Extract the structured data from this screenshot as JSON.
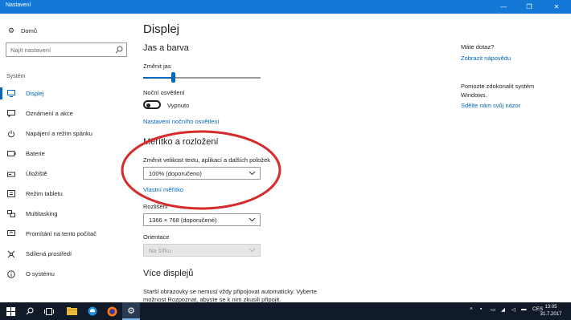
{
  "window": {
    "title": "Nastavení",
    "minimize_glyph": "—",
    "maximize_glyph": "❐",
    "close_glyph": "✕"
  },
  "nav": {
    "home_label": "Domů",
    "search_placeholder": "Najít nastavení",
    "group_label": "Systém",
    "items": [
      {
        "label": "Displej",
        "icon": "display-icon",
        "active": true
      },
      {
        "label": "Oznámení a akce",
        "icon": "notification-icon"
      },
      {
        "label": "Napájení a režim spánku",
        "icon": "power-icon"
      },
      {
        "label": "Baterie",
        "icon": "battery-icon"
      },
      {
        "label": "Úložiště",
        "icon": "storage-icon"
      },
      {
        "label": "Režim tabletu",
        "icon": "tablet-icon"
      },
      {
        "label": "Multitasking",
        "icon": "multitasking-icon"
      },
      {
        "label": "Promítání na tento počítač",
        "icon": "projecting-icon"
      },
      {
        "label": "Sdílená prostředí",
        "icon": "shared-experiences-icon"
      },
      {
        "label": "O systému",
        "icon": "info-icon"
      }
    ]
  },
  "main": {
    "title": "Displej",
    "section_color": "Jas a barva",
    "brightness_label": "Změnit jas",
    "brightness_level": 0.26,
    "night_light_label": "Noční osvětlení",
    "night_light_state": "Vypnuto",
    "night_light_link": "Nastavení nočního osvětlení",
    "section_scale": "Měřítko a rozložení",
    "scale_label": "Změnit velikost textu, aplikací a dalších položek",
    "scale_value": "100% (doporučeno)",
    "custom_scale_link": "Vlastní měřítko",
    "resolution_label": "Rozlišení",
    "resolution_value": "1366 × 768 (doporučené)",
    "orientation_label": "Orientace",
    "orientation_value": "Na šířku",
    "section_multi": "Více displejů",
    "multi_text": "Starší obrazovky se nemusí vždy připojovat automaticky. Vyberte možnost Rozpoznat, abyste se k nim zkusili připojit."
  },
  "help": {
    "question": "Máte dotaz?",
    "help_link": "Zobrazit nápovědu",
    "improve_text_1": "Pomozte zdokonalit systém",
    "improve_text_2": "Windows.",
    "feedback_link": "Sdělte nám svůj názor"
  },
  "annotation": {
    "color": "#d62b2b"
  },
  "taskbar": {
    "language": "CES",
    "time": "13:05",
    "date": "31.7.2017"
  },
  "colors": {
    "accent": "#0067c0",
    "titlebar": "#1479d6",
    "taskbar": "#101a29"
  }
}
